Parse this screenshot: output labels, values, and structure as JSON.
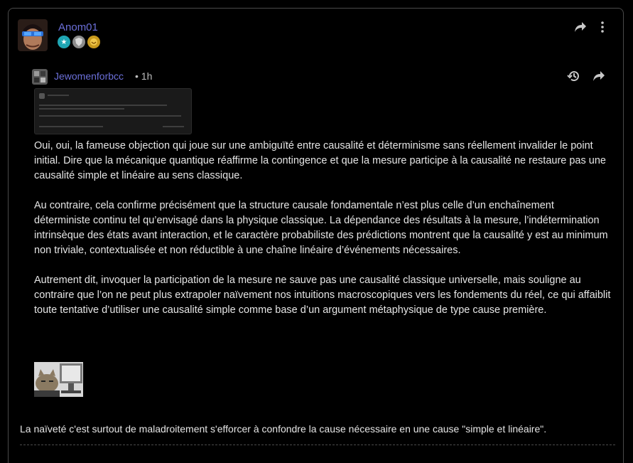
{
  "post": {
    "username": "Anom01",
    "badges": [
      "teal-star-badge",
      "silver-shield-badge",
      "gold-laugh-badge"
    ],
    "actions": [
      "share-icon",
      "more-vertical-icon"
    ]
  },
  "quote": {
    "username": "Jewomenforbcc",
    "separator": "•",
    "time": "1h",
    "actions": [
      "history-icon",
      "share-icon"
    ],
    "paragraphs": [
      "Oui, oui, la fameuse objection qui joue sur une ambiguïté entre causalité et déterminisme sans réellement invalider le point initial. Dire que la mécanique quantique réaffirme la contingence et que la mesure participe à la causalité ne restaure pas une causalité simple et linéaire au sens classique.",
      "Au contraire, cela confirme précisément que la structure causale fondamentale n’est plus celle d’un enchaînement déterministe continu tel qu’envisagé dans la physique classique. La dépendance des résultats à la mesure, l’indétermination intrinsèque des états avant interaction, et le caractère probabiliste des prédictions montrent que la causalité y est au minimum non triviale, contextualisée et non réductible à une chaîne linéaire d’événements nécessaires.",
      "Autrement dit, invoquer la participation de la mesure ne sauve pas une causalité classique universelle, mais souligne au contraire que l’on ne peut plus extrapoler naïvement nos intuitions macroscopiques vers les fondements du réel, ce qui affaiblit toute tentative d’utiliser une causalité simple comme base d’un argument métaphysique de type cause première."
    ]
  },
  "reply": {
    "text": "La naïveté c'est surtout de maladroitement s'efforcer à confondre la cause nécessaire en une cause \"simple et linéaire\"."
  },
  "colors": {
    "background": "#000000",
    "username": "#6b6fd8",
    "text": "#e6e6e6",
    "border": "#4a4a4a"
  }
}
